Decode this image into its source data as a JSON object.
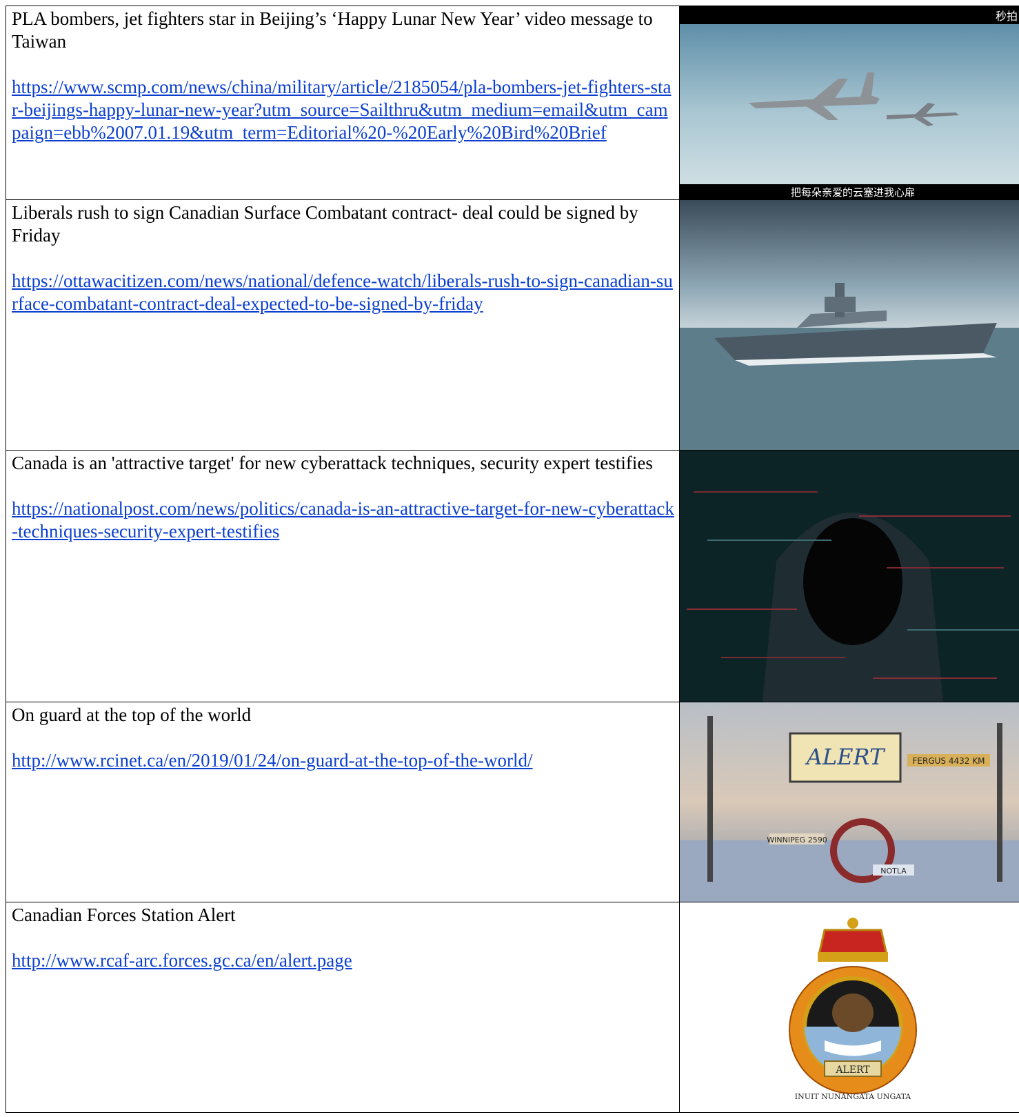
{
  "articles": [
    {
      "title": "PLA bombers, jet fighters star in Beijing’s ‘Happy Lunar New Year’ video message to Taiwan",
      "url": "https://www.scmp.com/news/china/military/article/2185054/pla-bombers-jet-fighters-star-beijings-happy-lunar-new-year?utm_source=Sailthru&utm_medium=email&utm_campaign=ebb%2007.01.19&utm_term=Editorial%20-%20Early%20Bird%20Brief",
      "image": {
        "subject": "bomber-and-fighter-jets-photo",
        "watermark": "秒拍",
        "caption": "把每朵亲爱的云塞进我心扉"
      }
    },
    {
      "title": "Liberals rush to sign Canadian Surface Combatant contract- deal could be signed by Friday",
      "url": "https://ottawacitizen.com/news/national/defence-watch/liberals-rush-to-sign-canadian-surface-combatant-contract-deal-expected-to-be-signed-by-friday",
      "image": {
        "subject": "warship-at-sea-photo"
      }
    },
    {
      "title": "Canada is an 'attractive target' for new cyberattack techniques, security expert testifies",
      "url": "https://nationalpost.com/news/politics/canada-is-an-attractive-target-for-new-cyberattack-techniques-security-expert-testifies",
      "image": {
        "subject": "hooded-hacker-glitch-photo"
      }
    },
    {
      "title": "On guard at the top of the world",
      "url": "http://www.rcinet.ca/en/2019/01/24/on-guard-at-the-top-of-the-world/",
      "image": {
        "subject": "alert-signpost-snow-photo",
        "sign_text": "ALERT",
        "labels": [
          "FERGUS 4432 KM",
          "WINNIPEG 2590",
          "NOTLA"
        ]
      }
    },
    {
      "title": "Canadian Forces Station Alert",
      "url": "http://www.rcaf-arc.forces.gc.ca/en/alert.page",
      "image": {
        "subject": "cfs-alert-badge",
        "badge_text": "ALERT",
        "motto": "INUIT NUNANGATA UNGATA"
      }
    }
  ]
}
